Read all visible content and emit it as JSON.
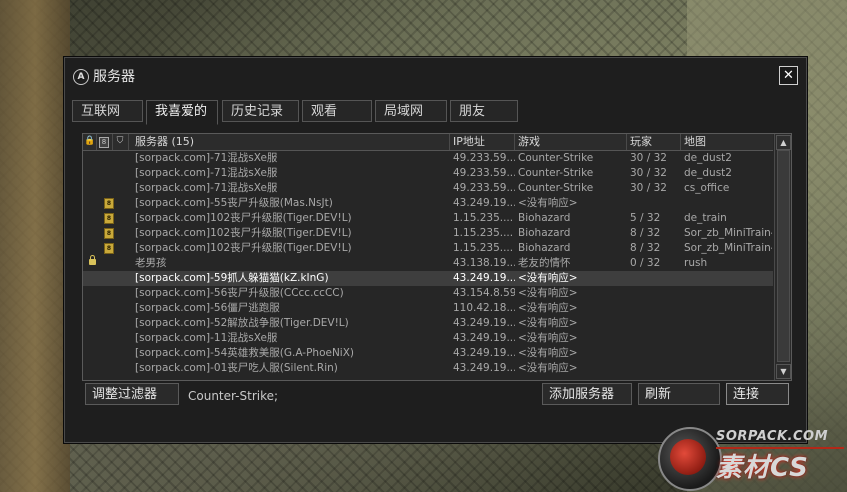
{
  "window": {
    "title": "服务器",
    "app_icon_text": "A",
    "close_glyph": "✕"
  },
  "tabs": [
    {
      "label": "互联网",
      "active": false
    },
    {
      "label": "我喜爱的",
      "active": true
    },
    {
      "label": "历史记录",
      "active": false
    },
    {
      "label": "观看",
      "active": false
    },
    {
      "label": "局域网",
      "active": false
    },
    {
      "label": "朋友",
      "active": false
    }
  ],
  "table": {
    "header_icons": [
      "lock-icon",
      "vac-icon",
      "shield-icon"
    ],
    "columns": {
      "name": "服务器 (15)",
      "ip": "IP地址",
      "game": "游戏",
      "players": "玩家",
      "map": "地图"
    },
    "rows": [
      {
        "lock": false,
        "vac": false,
        "name": "[sorpack.com]-71混战sXe服",
        "ip": "49.233.59...",
        "game": "Counter-Strike",
        "players": "30 / 32",
        "map": "de_dust2"
      },
      {
        "lock": false,
        "vac": false,
        "name": "[sorpack.com]-71混战sXe服",
        "ip": "49.233.59...",
        "game": "Counter-Strike",
        "players": "30 / 32",
        "map": "de_dust2"
      },
      {
        "lock": false,
        "vac": false,
        "name": "[sorpack.com]-71混战sXe服",
        "ip": "49.233.59...",
        "game": "Counter-Strike",
        "players": "30 / 32",
        "map": "cs_office"
      },
      {
        "lock": false,
        "vac": true,
        "name": "[sorpack.com]-55丧尸升级服(Mas.NsJt)",
        "ip": "43.249.19...",
        "game": "<没有响应>",
        "players": "",
        "map": ""
      },
      {
        "lock": false,
        "vac": true,
        "name": "[sorpack.com]102丧尸升级服(Tiger.DEV!L)",
        "ip": "1.15.235....",
        "game": "Biohazard",
        "players": "5 / 32",
        "map": "de_train"
      },
      {
        "lock": false,
        "vac": true,
        "name": "[sorpack.com]102丧尸升级服(Tiger.DEV!L)",
        "ip": "1.15.235....",
        "game": "Biohazard",
        "players": "8 / 32",
        "map": "Sor_zb_MiniTrain4"
      },
      {
        "lock": false,
        "vac": true,
        "name": "[sorpack.com]102丧尸升级服(Tiger.DEV!L)",
        "ip": "1.15.235....",
        "game": "Biohazard",
        "players": "8 / 32",
        "map": "Sor_zb_MiniTrain4"
      },
      {
        "lock": true,
        "vac": false,
        "name": "老男孩",
        "ip": "43.138.19...",
        "game": "老友的情怀",
        "players": "0 / 32",
        "map": "rush"
      },
      {
        "lock": false,
        "vac": false,
        "name": "[sorpack.com]-59抓人躲猫猫(kZ.kInG)",
        "ip": "43.249.19...",
        "game": "<没有响应>",
        "players": "",
        "map": "",
        "selected": true
      },
      {
        "lock": false,
        "vac": false,
        "name": "[sorpack.com]-56丧尸升级服(CCcc.ccCC)",
        "ip": "43.154.8.59",
        "game": "<没有响应>",
        "players": "",
        "map": ""
      },
      {
        "lock": false,
        "vac": false,
        "name": "[sorpack.com]-56僵尸逃跑服",
        "ip": "110.42.18...",
        "game": "<没有响应>",
        "players": "",
        "map": ""
      },
      {
        "lock": false,
        "vac": false,
        "name": "[sorpack.com]-52解放战争服(Tiger.DEV!L)",
        "ip": "43.249.19...",
        "game": "<没有响应>",
        "players": "",
        "map": ""
      },
      {
        "lock": false,
        "vac": false,
        "name": "[sorpack.com]-11混战sXe服",
        "ip": "43.249.19...",
        "game": "<没有响应>",
        "players": "",
        "map": ""
      },
      {
        "lock": false,
        "vac": false,
        "name": "[sorpack.com]-54英雄救美服(G.A-PhoeNiX)",
        "ip": "43.249.19...",
        "game": "<没有响应>",
        "players": "",
        "map": ""
      },
      {
        "lock": false,
        "vac": false,
        "name": "[sorpack.com]-01丧尸吃人服(Silent.Rin)",
        "ip": "43.249.19...",
        "game": "<没有响应>",
        "players": "",
        "map": ""
      }
    ]
  },
  "scrollbar": {
    "up_glyph": "▲",
    "down_glyph": "▼"
  },
  "bottom": {
    "filter_button": "调整过滤器",
    "filter_text": "Counter-Strike;",
    "add_server_button": "添加服务器",
    "refresh_button": "刷新",
    "connect_button": "连接"
  },
  "watermark": {
    "site": "SORPACK.COM",
    "brand": "素材CS"
  },
  "colors": {
    "window_bg": "#1e1e1e",
    "selected_row": "#3e3e3e",
    "text": "#a8a8a8",
    "lock": "#d9c25a",
    "vac": "#c9a93a",
    "watermark_red": "#b32818"
  }
}
